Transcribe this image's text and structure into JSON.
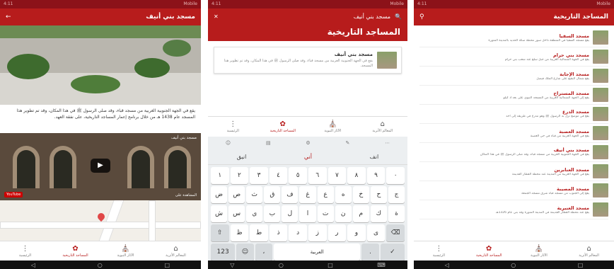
{
  "panel1": {
    "title": "مسجد بني أنيف",
    "back_icon": "arrow-right-icon",
    "description": "يقع في الجهة الجنوبية الغربية من مسجد قباء، وقد صلى الرسول ﷺ في هذا المكان، وقد تم تطوير هذا المسجد عام 1438 هـ من خلال برنامج إعمار المساجد التاريخية، على نفقة العهد.",
    "video_caption": "مسجد بني أنيف",
    "video_watch": "المشاهدة على",
    "video_brand": "YouTube"
  },
  "panel2": {
    "search_value": "مسجد بني أنيف",
    "heading": "المساجد التاريخية",
    "result": {
      "name": "مسجد بني أنيف",
      "desc": "يقع في الجهة الجنوبية الغربية من مسجد قباء، وقد صلى الرسول ﷺ في هذا المكان، وقد تم تطوير هذا المسجد."
    },
    "keyboard": {
      "suggestions": [
        "انيق",
        "أني",
        "انف"
      ],
      "row1": [
        "١",
        "٢",
        "٣",
        "٤",
        "٥",
        "٦",
        "٧",
        "٨",
        "٩",
        "٠"
      ],
      "row2": [
        "ض",
        "ص",
        "ث",
        "ق",
        "ف",
        "غ",
        "ع",
        "ه",
        "خ",
        "ح",
        "ج"
      ],
      "row3": [
        "ش",
        "س",
        "ي",
        "ب",
        "ل",
        "ا",
        "ت",
        "ن",
        "م",
        "ك",
        "ة"
      ],
      "row4": [
        "ظ",
        "ط",
        "ذ",
        "د",
        "ز",
        "ر",
        "و",
        "ى"
      ],
      "mode_key": "123",
      "space_label": "العربية"
    }
  },
  "panel3": {
    "title": "المساجد التاريخية",
    "items": [
      {
        "name": "مسجد السقيا",
        "desc": "يقع مسجد السقيا في المنطقة داخل سور محطة سكة الحديد بالمدينة المنورة"
      },
      {
        "name": "مسجد بني حرام",
        "desc": "يقع في الجهة الشمالية الغربية من جبل سلع عند شعب بني حرام"
      },
      {
        "name": "مسجد الإجابة",
        "desc": "يقع شمال البقيع على شارع الملك فيصل"
      },
      {
        "name": "مسجد المستراح",
        "desc": "يقع إلى الجهة الشمالية الغربية من المسجد النبوي على بعد 3 كيلو"
      },
      {
        "name": "مسجد الدرع",
        "desc": "يقع في موضع نزل به الرسول ﷺ وهو مدرع في طريقه إلى أحد"
      },
      {
        "name": "مسجد العصبة",
        "desc": "يقع في الجهة الغربية من قباء في حي العصبة"
      },
      {
        "name": "مسجد بني أنيف",
        "desc": "يقع في الجهة الجنوبية الغربية من مسجد قباء، وقد صلى الرسول ﷺ في هذا المكان"
      },
      {
        "name": "مسجد العنابرين",
        "desc": "يقع في الجهة الغربية من المدينة عند محطة القطار القديمة"
      },
      {
        "name": "مسجد المصيبة",
        "desc": "يقع إلى الجنوب من مسجد قباء شرق مسجد الجمعة"
      },
      {
        "name": "مسجد العنبرية",
        "desc": "يقع عند محطة القطار القديمة في المدينة المنورة وقد بني عام 1326هـ"
      }
    ]
  },
  "bottom_nav": {
    "items": [
      {
        "label": "الرئيسية",
        "icon": "menu-dots-icon"
      },
      {
        "label": "المساجد التاريخية",
        "icon": "mosque-icon"
      },
      {
        "label": "الآثار النبوية",
        "icon": "landmark-icon"
      },
      {
        "label": "المعالم الأثرية",
        "icon": "home-icon"
      }
    ]
  },
  "status_bar": {
    "left": "4:11",
    "right": "Mobile"
  },
  "accent_color": "#b71c1c"
}
